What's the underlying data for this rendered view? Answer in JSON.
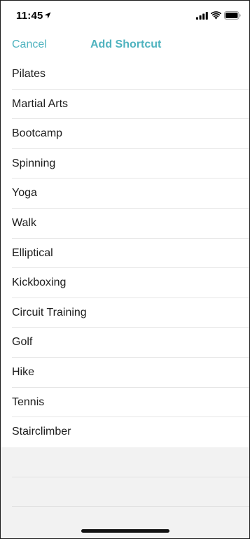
{
  "status_bar": {
    "time": "11:45",
    "icons": [
      "location-arrow-icon",
      "cellular-signal-icon",
      "wifi-icon",
      "battery-icon"
    ]
  },
  "nav": {
    "cancel_label": "Cancel",
    "title": "Add Shortcut"
  },
  "colors": {
    "accent": "#4fb3bf",
    "empty_background": "#f2f2f2",
    "divider": "#e6e6e6"
  },
  "activities": [
    "Pilates",
    "Martial Arts",
    "Bootcamp",
    "Spinning",
    "Yoga",
    "Walk",
    "Elliptical",
    "Kickboxing",
    "Circuit Training",
    "Golf",
    "Hike",
    "Tennis",
    "Stairclimber"
  ]
}
